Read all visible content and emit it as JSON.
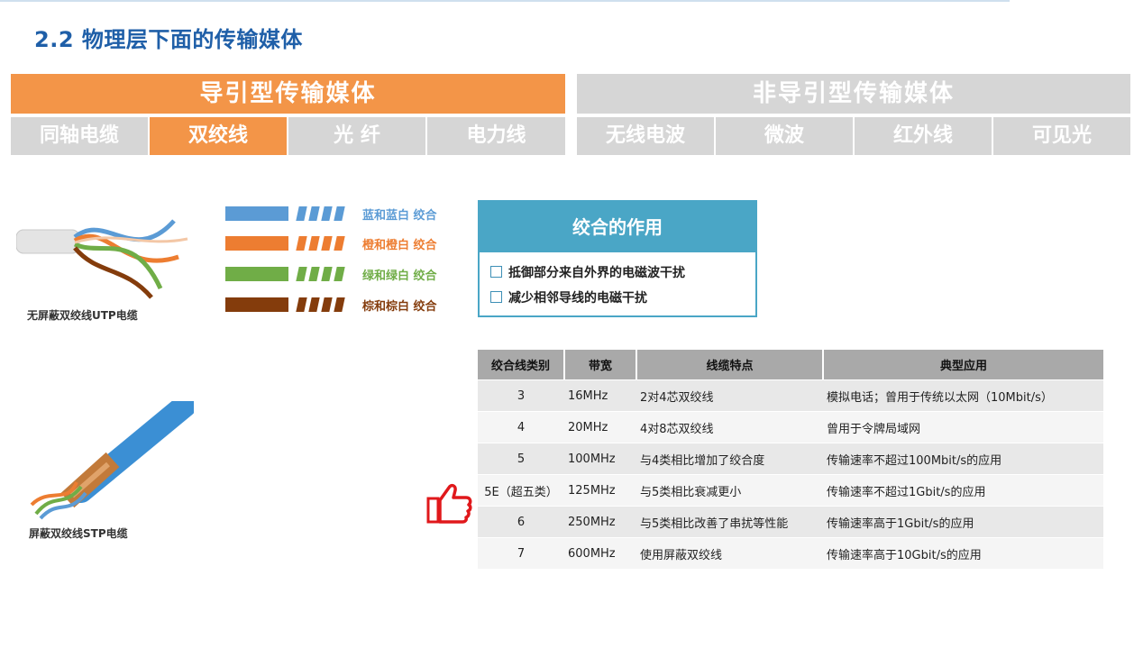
{
  "title": "2.2 物理层下面的传输媒体",
  "categories": {
    "guided": {
      "label": "导引型传输媒体",
      "items": [
        "同轴电缆",
        "双绞线",
        "光 纤",
        "电力线"
      ],
      "active_index": 1
    },
    "unguided": {
      "label": "非导引型传输媒体",
      "items": [
        "无线电波",
        "微波",
        "红外线",
        "可见光"
      ]
    }
  },
  "pairs": [
    {
      "label": "蓝和蓝白 绞合",
      "color": "#5b9bd5"
    },
    {
      "label": "橙和橙白 绞合",
      "color": "#ed7d31"
    },
    {
      "label": "绿和绿白 绞合",
      "color": "#70ad47"
    },
    {
      "label": "棕和棕白 绞合",
      "color": "#843c0c"
    }
  ],
  "utp_caption": "无屏蔽双绞线UTP电缆",
  "stp_caption": "屏蔽双绞线STP电缆",
  "twist_box": {
    "title": "绞合的作用",
    "items": [
      "抵御部分来自外界的电磁波干扰",
      "减少相邻导线的电磁干扰"
    ]
  },
  "table": {
    "headers": [
      "绞合线类别",
      "带宽",
      "线缆特点",
      "典型应用"
    ],
    "rows": [
      [
        "3",
        "16MHz",
        "2对4芯双绞线",
        "模拟电话；曾用于传统以太网（10Mbit/s）"
      ],
      [
        "4",
        "20MHz",
        "4对8芯双绞线",
        "曾用于令牌局域网"
      ],
      [
        "5",
        "100MHz",
        "与4类相比增加了绞合度",
        "传输速率不超过100Mbit/s的应用"
      ],
      [
        "5E（超五类）",
        "125MHz",
        "与5类相比衰减更小",
        "传输速率不超过1Gbit/s的应用"
      ],
      [
        "6",
        "250MHz",
        "与5类相比改善了串扰等性能",
        "传输速率高于1Gbit/s的应用"
      ],
      [
        "7",
        "600MHz",
        "使用屏蔽双绞线",
        "传输速率高于10Gbit/s的应用"
      ]
    ]
  },
  "icons": {
    "thumb": "thumbs-up-icon"
  },
  "colors": {
    "accent": "#f39548",
    "inactive": "#d6d6d6",
    "title": "#1f5fa8",
    "box": "#4aa6c6"
  }
}
